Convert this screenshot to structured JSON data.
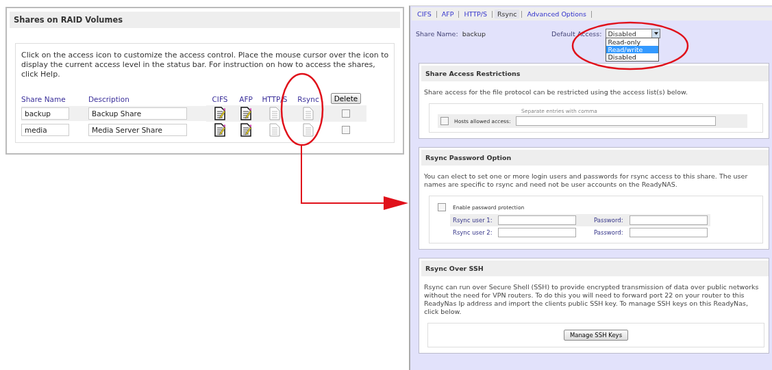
{
  "shares_panel": {
    "title": "Shares on RAID Volumes",
    "instructions": "Click on the access icon to customize the access control. Place the mouse cursor over the icon to display the current access level in the status bar. For instruction on how to access the shares, click Help.",
    "columns": [
      "Share Name",
      "Description",
      "CIFS",
      "AFP",
      "HTTP/S",
      "Rsync"
    ],
    "delete_button": "Delete",
    "rows": [
      {
        "name": "backup",
        "description": "Backup Share",
        "access": [
          {
            "kind": "edit"
          },
          {
            "kind": "edit"
          },
          {
            "kind": "plain"
          },
          {
            "kind": "plain"
          }
        ],
        "checked": false
      },
      {
        "name": "media",
        "description": "Media Server Share",
        "access": [
          {
            "kind": "edit"
          },
          {
            "kind": "edit"
          },
          {
            "kind": "plain"
          },
          {
            "kind": "plain"
          }
        ],
        "checked": false
      }
    ]
  },
  "share_settings": {
    "tabs": [
      {
        "label": "CIFS",
        "selected": false
      },
      {
        "label": "AFP",
        "selected": false
      },
      {
        "label": "HTTP/S",
        "selected": false
      },
      {
        "label": "Rsync",
        "selected": true
      },
      {
        "label": "Advanced Options",
        "selected": false
      }
    ],
    "share_name_label": "Share Name:",
    "share_name": "backup",
    "default_access_label": "Default Access:",
    "default_access_value": "Disabled",
    "default_access_options": [
      {
        "label": "Read-only",
        "selected": false
      },
      {
        "label": "Read/write",
        "selected": true
      },
      {
        "label": "Disabled",
        "selected": false
      }
    ],
    "restrictions": {
      "title": "Share Access Restrictions",
      "text": "Share access for the file protocol can be restricted using the access list(s) below.",
      "hint": "Separate entries with comma",
      "hosts_label": "Hosts allowed access:",
      "hosts_checked": false
    },
    "password_option": {
      "title": "Rsync Password Option",
      "text": "You can elect to set one or more login users and passwords for rsync access to this share. The user names are specific to rsync and need not be user accounts on the ReadyNAS.",
      "enable_label": "Enable password protection",
      "enable_checked": false,
      "users": [
        {
          "user_label": "Rsync user 1:",
          "password_label": "Password:"
        },
        {
          "user_label": "Rsync user 2:",
          "password_label": "Password:"
        }
      ]
    },
    "ssh": {
      "title": "Rsync Over SSH",
      "text": "Rsync can run over Secure Shell (SSH) to provide encrypted transmission of data over public networks without the need for VPN routers. To do this you will need to forward port 22 on your router to this ReadyNas Ip address and import the clients public SSH key. To manage SSH keys on this ReadyNas, click below.",
      "button": "Manage SSH Keys"
    }
  }
}
